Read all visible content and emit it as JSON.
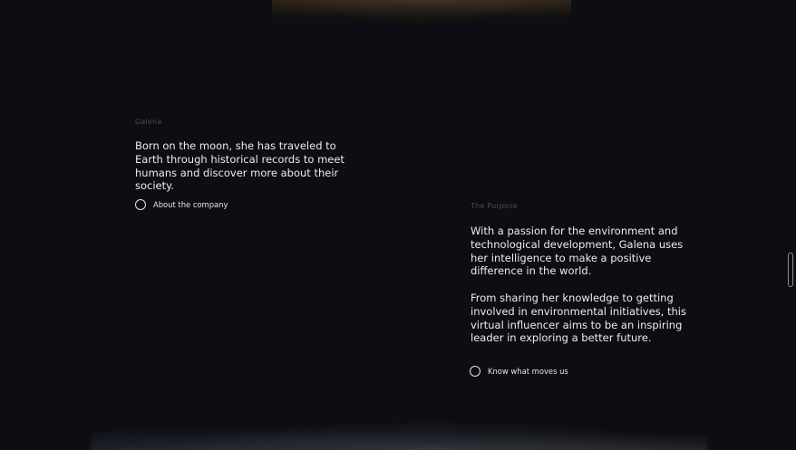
{
  "galena_section": {
    "eyebrow": "Galena",
    "description": "Born on the moon, she has traveled to Earth through historical records to meet humans and discover more about their society.",
    "cta_label": "About the company"
  },
  "purpose_section": {
    "eyebrow": "The Purpose",
    "paragraph_1": "With a passion for the environment and technological development, Galena uses her intelligence to make a positive difference in the world.",
    "paragraph_2": "From sharing her knowledge to getting involved in environmental initiatives, this virtual influencer aims to be an inspiring leader in exploring a better future.",
    "cta_label": "Know what moves us"
  },
  "colors": {
    "background": "#0d0e13",
    "text": "#ececf1",
    "eyebrow": "#4a4b55"
  }
}
